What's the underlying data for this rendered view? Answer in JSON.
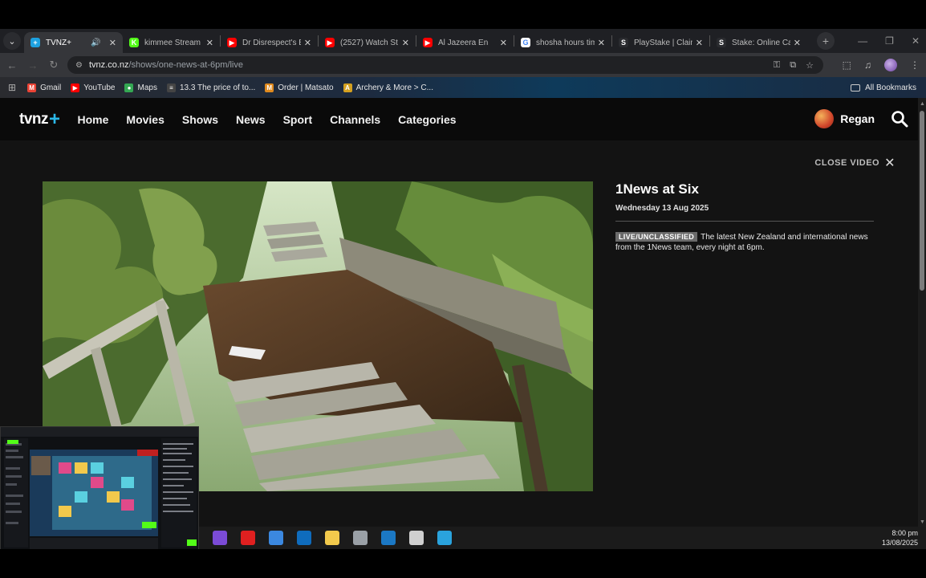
{
  "browser": {
    "tabs": [
      {
        "title": "TVNZ+",
        "favicon_color": "#1da1e0",
        "favicon_glyph": "+",
        "active": true,
        "audio": true
      },
      {
        "title": "kimmee Stream - ",
        "favicon_color": "#53fc18",
        "favicon_glyph": "K"
      },
      {
        "title": "Dr Disrespect's Bl",
        "favicon_color": "#ff0000",
        "favicon_glyph": "▶"
      },
      {
        "title": "(2527) Watch St",
        "favicon_color": "#ff0000",
        "favicon_glyph": "▶"
      },
      {
        "title": "Al Jazeera En",
        "favicon_color": "#ff0000",
        "favicon_glyph": "▶"
      },
      {
        "title": "shosha hours tim",
        "favicon_color": "#ffffff",
        "favicon_glyph": "G"
      },
      {
        "title": "PlayStake | Claim",
        "favicon_color": "#2a2b2f",
        "favicon_glyph": "S"
      },
      {
        "title": "Stake: Online Cas",
        "favicon_color": "#2a2b2f",
        "favicon_glyph": "S"
      }
    ],
    "url": {
      "domain": "tvnz.co.nz",
      "path": "/shows/one-news-at-6pm/live"
    },
    "bookmarks": [
      {
        "label": "Gmail",
        "color": "#ea4335",
        "glyph": "M"
      },
      {
        "label": "YouTube",
        "color": "#ff0000",
        "glyph": "▶"
      },
      {
        "label": "Maps",
        "color": "#34a853",
        "glyph": "●"
      },
      {
        "label": "13.3 The price of to...",
        "color": "#444",
        "glyph": "≡"
      },
      {
        "label": "Order | Matsato",
        "color": "#e08a1e",
        "glyph": "M"
      },
      {
        "label": "Archery & More > C...",
        "color": "#d4a020",
        "glyph": "A"
      }
    ],
    "all_bookmarks": "All Bookmarks"
  },
  "site": {
    "logo_text": "tvnz",
    "logo_plus": "+",
    "nav": [
      "Home",
      "Movies",
      "Shows",
      "News",
      "Sport",
      "Channels",
      "Categories"
    ],
    "user_name": "Regan",
    "close_video": "CLOSE VIDEO",
    "close_glyph": "✕"
  },
  "show": {
    "title": "1News at Six",
    "date": "Wednesday 13 Aug 2025",
    "badge": "LIVE/UNCLASSIFIED",
    "description": "The latest New Zealand and international news from the 1News team, every night at 6pm."
  },
  "taskbar": {
    "time": "8:00 pm",
    "date": "13/08/2025",
    "icons": [
      {
        "name": "twitch-icon",
        "color": "#7b4bd6"
      },
      {
        "name": "lightning-app-icon",
        "color": "#e02020"
      },
      {
        "name": "store-icon",
        "color": "#3b88e0"
      },
      {
        "name": "outlook-icon",
        "color": "#0f6cbd"
      },
      {
        "name": "folder-icon",
        "color": "#f2c94c"
      },
      {
        "name": "feather-app-icon",
        "color": "#9aa0a6"
      },
      {
        "name": "steam-icon",
        "color": "#1b78c4"
      },
      {
        "name": "settings-gear-icon",
        "color": "#d0d0d0"
      },
      {
        "name": "telegram-icon",
        "color": "#2aa3dd"
      }
    ]
  }
}
